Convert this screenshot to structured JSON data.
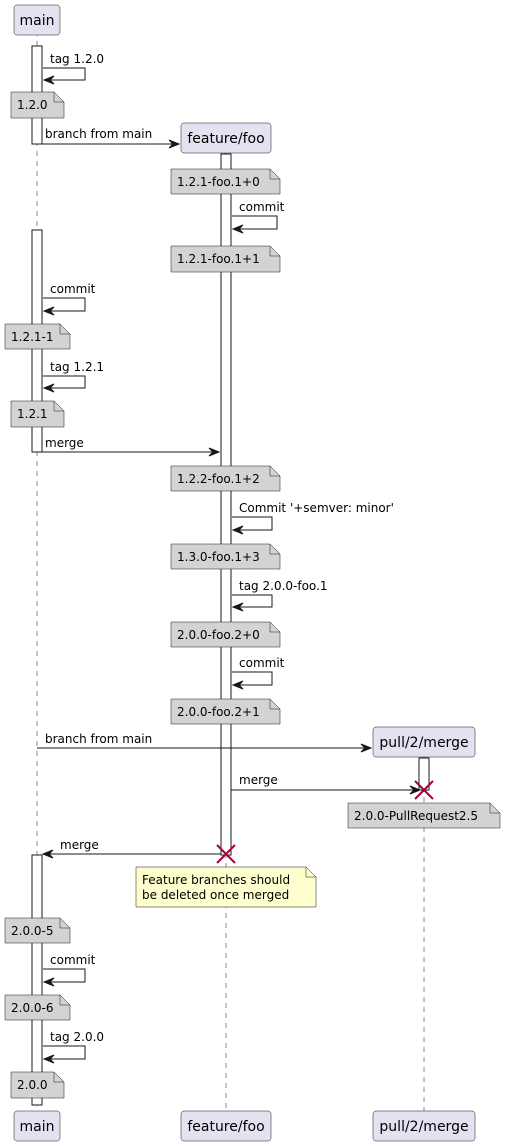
{
  "participants": [
    {
      "id": "main",
      "label": "main"
    },
    {
      "id": "feature",
      "label": "feature/foo"
    },
    {
      "id": "pull",
      "label": "pull/2/merge"
    }
  ],
  "messages": [
    {
      "from": "main",
      "to": "main",
      "label": "tag 1.2.0"
    },
    {
      "from": "main",
      "to": "feature",
      "label": "branch from main"
    },
    {
      "from": "feature",
      "to": "feature",
      "label": "commit"
    },
    {
      "from": "main",
      "to": "main",
      "label": "commit"
    },
    {
      "from": "main",
      "to": "main",
      "label": "tag 1.2.1"
    },
    {
      "from": "main",
      "to": "feature",
      "label": "merge"
    },
    {
      "from": "feature",
      "to": "feature",
      "label": "Commit '+semver: minor'"
    },
    {
      "from": "feature",
      "to": "feature",
      "label": "tag 2.0.0-foo.1"
    },
    {
      "from": "feature",
      "to": "feature",
      "label": "commit"
    },
    {
      "from": "main",
      "to": "pull",
      "label": "branch from main"
    },
    {
      "from": "feature",
      "to": "pull",
      "label": "merge"
    },
    {
      "from": "feature",
      "to": "main",
      "label": "merge"
    },
    {
      "from": "main",
      "to": "main",
      "label": "commit"
    },
    {
      "from": "main",
      "to": "main",
      "label": "tag 2.0.0"
    }
  ],
  "notes": [
    {
      "on": "main",
      "lines": [
        "1.2.0"
      ],
      "color": "#d3d3d3"
    },
    {
      "on": "feature",
      "lines": [
        "1.2.1-foo.1+0"
      ],
      "color": "#d3d3d3"
    },
    {
      "on": "feature",
      "lines": [
        "1.2.1-foo.1+1"
      ],
      "color": "#d3d3d3"
    },
    {
      "on": "main",
      "lines": [
        "1.2.1-1"
      ],
      "color": "#d3d3d3"
    },
    {
      "on": "main",
      "lines": [
        "1.2.1"
      ],
      "color": "#d3d3d3"
    },
    {
      "on": "feature",
      "lines": [
        "1.2.2-foo.1+2"
      ],
      "color": "#d3d3d3"
    },
    {
      "on": "feature",
      "lines": [
        "1.3.0-foo.1+3"
      ],
      "color": "#d3d3d3"
    },
    {
      "on": "feature",
      "lines": [
        "2.0.0-foo.2+0"
      ],
      "color": "#d3d3d3"
    },
    {
      "on": "feature",
      "lines": [
        "2.0.0-foo.2+1"
      ],
      "color": "#d3d3d3"
    },
    {
      "on": "pull",
      "lines": [
        "2.0.0-PullRequest2.5"
      ],
      "color": "#d3d3d3"
    },
    {
      "on": "feature",
      "lines": [
        "Feature branches should",
        "be deleted once merged"
      ],
      "color": "#fefece"
    },
    {
      "on": "main",
      "lines": [
        "2.0.0-5"
      ],
      "color": "#d3d3d3"
    },
    {
      "on": "main",
      "lines": [
        "2.0.0-6"
      ],
      "color": "#d3d3d3"
    },
    {
      "on": "main",
      "lines": [
        "2.0.0"
      ],
      "color": "#d3d3d3"
    }
  ],
  "destroyed": [
    "pull",
    "feature"
  ],
  "colors": {
    "participant_fill": "#e2e2f0",
    "stroke": "#181818",
    "destroy": "#a80036",
    "note_gray": "#d3d3d3",
    "note_yellow": "#fefece"
  }
}
